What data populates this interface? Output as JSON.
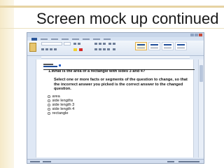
{
  "slide": {
    "title": "Screen mock up continued"
  },
  "document": {
    "question": "1.What is the area of a rectangle with sides 3 and 4?",
    "instruction": "Select one or more facts or segments of the question to change, so that the incorrect answer you picked is the correct answer to the changed question.",
    "answers": [
      {
        "label": "area"
      },
      {
        "label": "side lengths"
      },
      {
        "label": "side length 3"
      },
      {
        "label": "side length 4"
      },
      {
        "label": "rectangle"
      }
    ]
  },
  "colors": {
    "accent_gold": "#e6d3a3",
    "word_blue": "#2b579a"
  }
}
